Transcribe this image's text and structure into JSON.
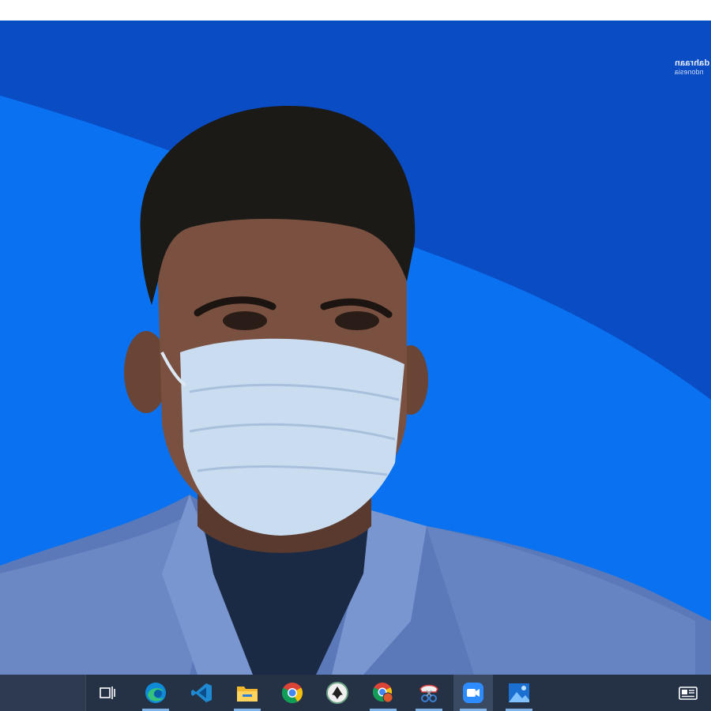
{
  "watermark": {
    "line1": "dahraan",
    "line2": "ndonesia"
  },
  "colors": {
    "background_light_blue": "#0a72f0",
    "background_dark_blue": "#0a4cc4",
    "taskbar": "#253246",
    "running_indicator": "#7fb3e6"
  },
  "taskbar": {
    "icons": [
      {
        "name": "task-view-icon",
        "running": false
      },
      {
        "name": "edge-icon",
        "running": true
      },
      {
        "name": "vscode-icon",
        "running": false
      },
      {
        "name": "file-explorer-icon",
        "running": true
      },
      {
        "name": "chrome-icon",
        "running": false
      },
      {
        "name": "inkscape-icon",
        "running": false
      },
      {
        "name": "chrome-badge-icon",
        "running": true
      },
      {
        "name": "snipping-tool-icon",
        "running": true
      },
      {
        "name": "zoom-icon",
        "running": true,
        "active": true
      },
      {
        "name": "photos-icon",
        "running": true
      }
    ],
    "tray": [
      {
        "name": "news-icon"
      }
    ]
  }
}
